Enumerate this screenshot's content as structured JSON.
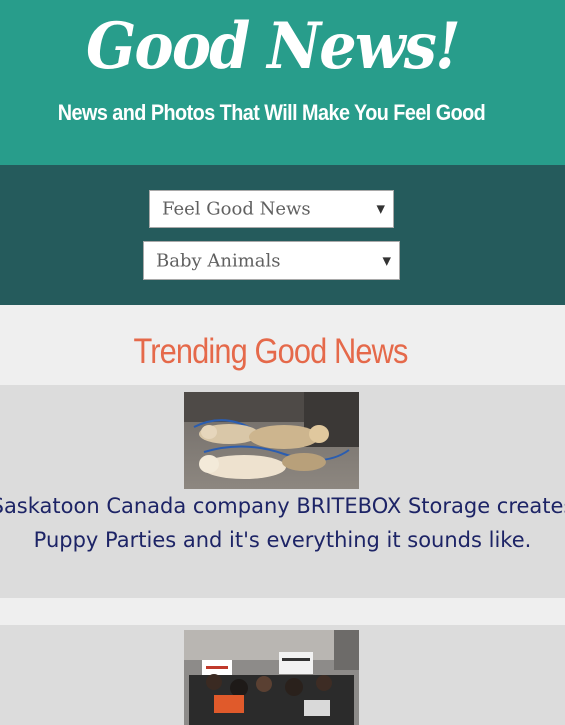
{
  "header": {
    "logo_text": "Good News!",
    "tagline": "News and Photos That Will Make You Feel Good"
  },
  "nav": {
    "category_select": {
      "selected": "Feel Good News"
    },
    "topic_select": {
      "selected": "Baby Animals"
    },
    "caret_icon": "triangle-down"
  },
  "trending": {
    "title": "Trending Good News",
    "articles": [
      {
        "headline": "Saskatoon Canada company BRITEBOX Storage creates Puppy Parties and it's everything it sounds like.",
        "image": "puppies-on-floor-photo"
      },
      {
        "headline": "",
        "image": "protest-crowd-photo"
      }
    ]
  },
  "colors": {
    "header_bg": "#289d8b",
    "nav_bg": "#255b5c",
    "accent_title": "#e5694a",
    "card_bg": "#dcdcdc",
    "headline_text": "#1d2466"
  }
}
